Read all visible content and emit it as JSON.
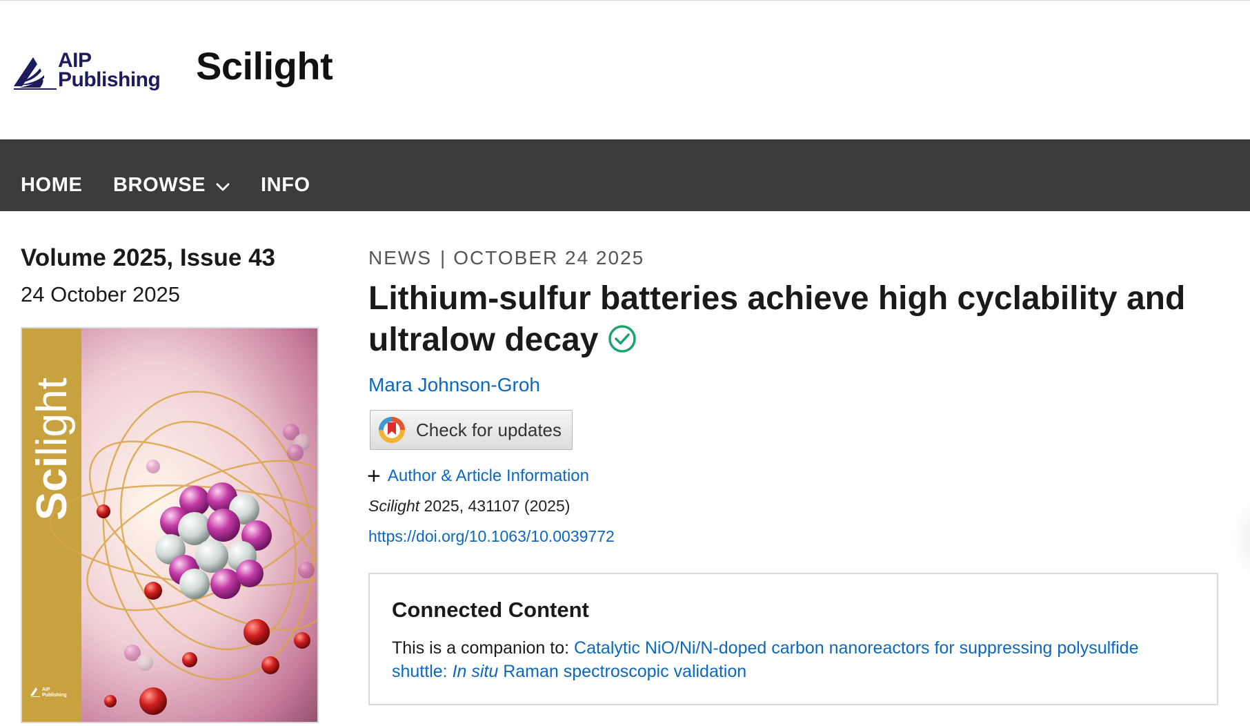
{
  "header": {
    "publisher_line1": "AIP",
    "publisher_line2": "Publishing",
    "site_title": "Scilight"
  },
  "nav": {
    "items": [
      {
        "label": "HOME"
      },
      {
        "label": "BROWSE"
      },
      {
        "label": "INFO"
      }
    ]
  },
  "sidebar": {
    "issue": "Volume 2025, Issue 43",
    "date": "24 October 2025",
    "cover": {
      "title_bold": "Sci",
      "title_light": "light",
      "publisher_line1": "AIP",
      "publisher_line2": "Publishing",
      "band_color": "#c9a240"
    }
  },
  "article": {
    "category": "NEWS",
    "separator": "|",
    "date": "OCTOBER 24 2025",
    "title": "Lithium-sulfur batteries achieve high cyclability and ultralow decay",
    "author": "Mara Johnson-Groh",
    "check_updates_label": "Check for updates",
    "author_info_icon": "+",
    "author_info_label": "Author & Article Information",
    "citation_journal": "Scilight",
    "citation_rest": " 2025, 431107 (2025)",
    "doi": "https://doi.org/10.1063/10.0039772"
  },
  "connected_content": {
    "heading": "Connected Content",
    "intro": "This is a companion to: ",
    "link_part1": "Catalytic NiO/Ni/N-doped carbon nanoreactors for suppressing polysulfide shuttle: ",
    "link_italic": "In situ",
    "link_part2": " Raman spectroscopic validation"
  },
  "colors": {
    "nav_bg": "#3b3b3b",
    "link": "#0a67c2",
    "verified": "#1aa36c",
    "brand_navy": "#1d1a5e"
  },
  "icons": [
    "aip-logo-icon",
    "chevron-down-icon",
    "verified-check-icon",
    "crossmark-icon",
    "plus-icon"
  ]
}
